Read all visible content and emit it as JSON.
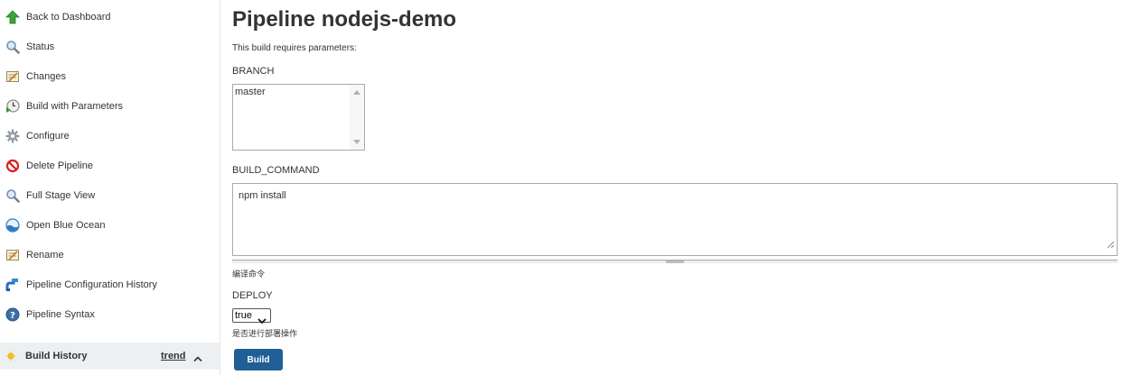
{
  "sidebar": {
    "items": [
      {
        "label": "Back to Dashboard",
        "icon": "up-arrow-icon"
      },
      {
        "label": "Status",
        "icon": "magnifier-icon"
      },
      {
        "label": "Changes",
        "icon": "notepad-icon"
      },
      {
        "label": "Build with Parameters",
        "icon": "clock-play-icon"
      },
      {
        "label": "Configure",
        "icon": "gear-icon"
      },
      {
        "label": "Delete Pipeline",
        "icon": "no-entry-icon"
      },
      {
        "label": "Full Stage View",
        "icon": "magnifier-icon"
      },
      {
        "label": "Open Blue Ocean",
        "icon": "blue-ocean-icon"
      },
      {
        "label": "Rename",
        "icon": "notepad-icon"
      },
      {
        "label": "Pipeline Configuration History",
        "icon": "pipe-icon"
      },
      {
        "label": "Pipeline Syntax",
        "icon": "help-icon"
      }
    ],
    "build_history": {
      "title": "Build History",
      "trend_label": "trend",
      "icon": "sun-icon"
    }
  },
  "main": {
    "title": "Pipeline nodejs-demo",
    "description": "This build requires parameters:",
    "params": {
      "branch": {
        "label": "BRANCH",
        "value": "master"
      },
      "build_command": {
        "label": "BUILD_COMMAND",
        "value": "npm install",
        "hint": "编译命令"
      },
      "deploy": {
        "label": "DEPLOY",
        "selected": "true",
        "hint": "是否进行部署操作"
      }
    },
    "build_button": "Build"
  },
  "colors": {
    "accent": "#1f5f95",
    "sidebar_highlight": "#edf0f2"
  }
}
